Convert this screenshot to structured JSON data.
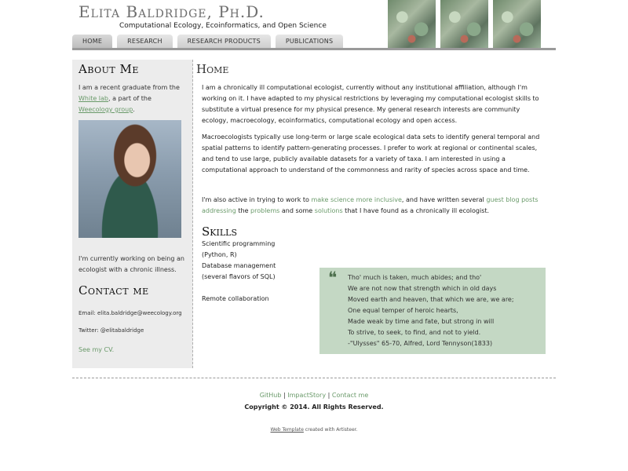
{
  "header": {
    "title": "Elita Baldridge, Ph.D.",
    "subtitle": "Computational Ecology, Ecoinformatics, and Open Science"
  },
  "nav": {
    "tabs": [
      "HOME",
      "RESEARCH",
      "RESEARCH PRODUCTS",
      "PUBLICATIONS"
    ],
    "active": "HOME"
  },
  "sidebar": {
    "about_heading": "About Me",
    "about_text_1": "I am a recent graduate from the",
    "about_link_lab": "White lab",
    "about_text_2": ", a part of the",
    "about_link_group": "Weecology group",
    "about_text_3": ".",
    "working_text": "I'm currently working on being an ecologist with a chronic illness.",
    "contact_heading": "Contact me",
    "email": "Email: elita.baldridge@weecology.org",
    "twitter": "Twitter: @elitabaldridge",
    "cv_link": "See my CV."
  },
  "main": {
    "title": "Home",
    "para1": "I am a chronically ill computational ecologist, currently without any institutional affiliation, although I'm working on it.  I have adapted to my physical restrictions by leveraging my computational ecologist skills to substitute a virtual presence for my physical presence.  My general research interests are community ecology, macroecology, ecoinformatics, computational ecology and open access.",
    "para2": "Macroecologists typically use long-term or large scale ecological data sets to identify general temporal and spatial patterns to identify pattern-generating processes.   I prefer to work at regional or continental scales, and tend to use large, publicly available datasets for a variety of taxa.  I am interested in using a computational approach to understand of the commonness and rarity of species across space and time.",
    "para3": {
      "t1": "I'm also active in trying to work to ",
      "l1": "make science more inclusive",
      "t2": ", and have written several ",
      "l2": "guest blog posts addressing",
      "t3": " the ",
      "l3": "problems",
      "t4": " and some ",
      "l4": "solutions",
      "t5": " that I have found as a chronically ill ecologist."
    },
    "skills_heading": "Skills",
    "skills": [
      "Scientific programming",
      "(Python, R)",
      "Database management",
      "(several flavors of SQL)",
      "",
      "Remote collaboration"
    ],
    "quote": [
      "Tho' much is taken, much abides; and tho'",
      "We are not now that strength which in old days",
      "Moved earth and heaven, that which we are, we are;",
      "One equal temper of heroic hearts,",
      "Made weak by time and fate, but strong in will",
      "To strive, to seek, to find, and not to yield.",
      "-\"Ulysses\" 65-70, Alfred, Lord Tennyson(1833)"
    ]
  },
  "footer": {
    "links": [
      "GitHub",
      "ImpactStory",
      "Contact me"
    ],
    "copyright": "Copyright © 2014. All Rights Reserved.",
    "template_link": "Web Template",
    "template_text": " created with Artisteer."
  },
  "colors": {
    "link_green": "#6a9a6a",
    "quote_bg": "#c4d8c4",
    "sidebar_bg": "#ececec"
  }
}
